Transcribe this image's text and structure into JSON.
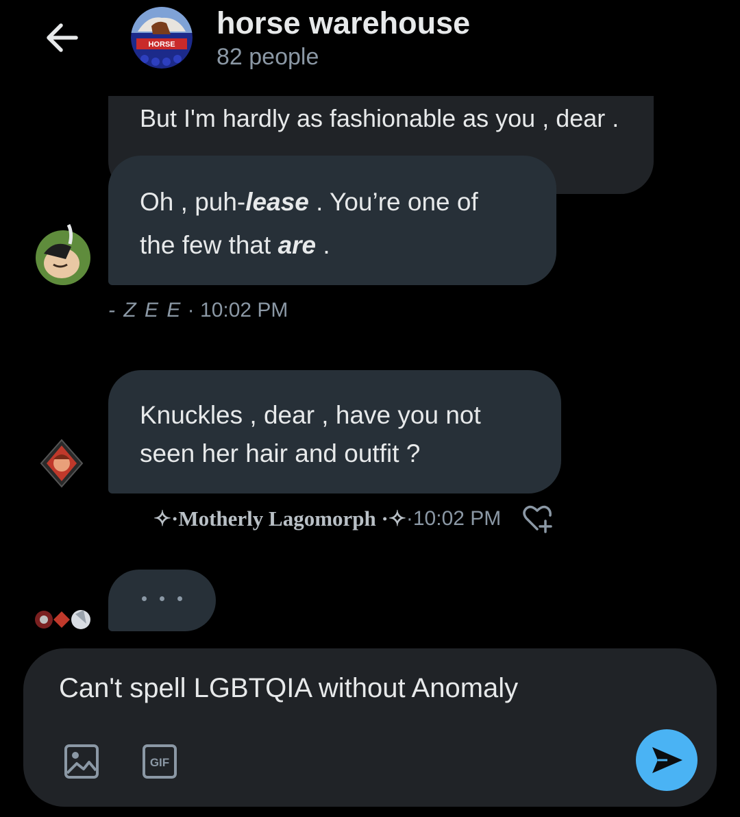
{
  "header": {
    "title": "horse warehouse",
    "subtitle": "82 people",
    "avatar_text": "HORSE"
  },
  "messages": [
    {
      "text": "But I'm hardly as fashionable as you , dear ."
    },
    {
      "line1_a": "Oh , puh-",
      "line1_em": "lease",
      "line1_b": " . You’re one of",
      "line2_a": "the few that ",
      "line2_em": "are",
      "line2_b": " ."
    },
    {
      "line1": "Knuckles , dear , have you not",
      "line2": "seen her hair and outfit ?"
    }
  ],
  "meta": {
    "first": {
      "name": "- Z E E",
      "sep": " · ",
      "time": "10:02 PM"
    },
    "second": {
      "prefix": "✧·",
      "name": "Motherly Lagomorph",
      "suffix": " ·✧",
      "sep": " · ",
      "time": "10:02 PM"
    }
  },
  "composer": {
    "value": "Can't spell LGBTQIA without Anomaly",
    "gif_label": "GIF"
  },
  "icons": {
    "back": "back-arrow-icon",
    "like": "heart-plus-icon",
    "media": "image-icon",
    "gif": "gif-icon",
    "send": "send-icon"
  },
  "colors": {
    "accent": "#4ab3f4",
    "bubble": "#273038",
    "muted": "#8b98a5"
  }
}
